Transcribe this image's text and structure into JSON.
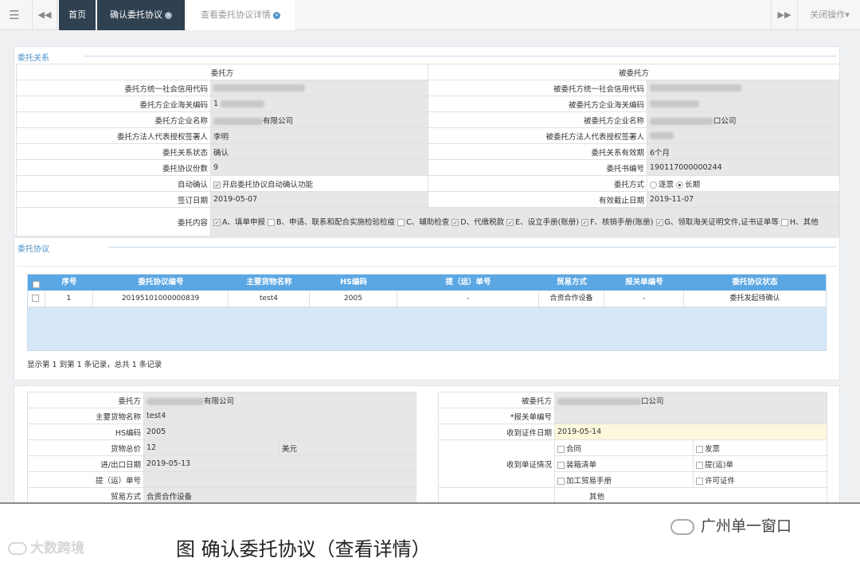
{
  "topbar": {
    "menu_icon": "☰",
    "back_icon": "◀◀",
    "home": "首页",
    "tab_active": "确认委托协议",
    "tab_detail": "查看委托协议详情",
    "fwd_icon": "▶▶",
    "close_ops": "关闭操作▾"
  },
  "relation": {
    "title": "委托关系",
    "head_left": "委托方",
    "head_right": "被委托方",
    "rows": [
      {
        "l1": "委托方统一社会信用代码",
        "v1": "",
        "l2": "被委托方统一社会信用代码",
        "v2": ""
      },
      {
        "l1": "委托方企业海关编码",
        "v1": "1",
        "l2": "被委托方企业海关编码",
        "v2": ""
      },
      {
        "l1": "委托方企业名称",
        "v1": "有限公司",
        "l2": "被委托方企业名称",
        "v2": "口公司"
      },
      {
        "l1": "委托方法人代表授权签署人",
        "v1": "李明",
        "l2": "被委托方法人代表授权签署人",
        "v2": ""
      },
      {
        "l1": "委托关系状态",
        "v1": "确认",
        "l2": "委托关系有效期",
        "v2": "6个月"
      },
      {
        "l1": "委托协议份数",
        "v1": "9",
        "l2": "委托书编号",
        "v2": "190117000000244"
      }
    ],
    "auto_label": "自动确认",
    "auto_text": "开启委托协议自动确认功能",
    "mode_label": "委托方式",
    "mode_opt1": "逐票",
    "mode_opt2": "长期",
    "sign_label": "签订日期",
    "sign_date": "2019-05-07",
    "end_label": "有效截止日期",
    "end_date": "2019-11-07",
    "content_label": "委托内容",
    "content_items": [
      "A、填单申报",
      "B、申请、联系和配合实施检验检疫",
      "C、辅助检查",
      "D、代缴税款",
      "E、设立手册(账册)",
      "F、核销手册(账册)",
      "G、领取海关证明文件,证书证单等",
      "H、其他"
    ]
  },
  "agreement": {
    "title": "委托协议",
    "columns": [
      "序号",
      "委托协议编号",
      "主要货物名称",
      "HS编码",
      "提（运）单号",
      "贸易方式",
      "报关单编号",
      "委托协议状态"
    ],
    "rows": [
      [
        "1",
        "20195101000000839",
        "test4",
        "2005",
        "-",
        "合资合作设备",
        "-",
        "委托发起待确认"
      ]
    ],
    "footer": "显示第 1 到第 1 条记录，总共 1 条记录"
  },
  "detail": {
    "left": [
      {
        "label": "委托方",
        "value": "有限公司"
      },
      {
        "label": "主要货物名称",
        "value": "test4"
      },
      {
        "label": "HS编码",
        "value": "2005"
      },
      {
        "label": "货物总价",
        "value": "12",
        "unit": "美元"
      },
      {
        "label": "进/出口日期",
        "value": "2019-05-13"
      },
      {
        "label": "提（运）单号",
        "value": ""
      },
      {
        "label": "贸易方式",
        "value": "合资合作设备"
      }
    ],
    "right": {
      "principal_label": "被委托方",
      "principal_value": "口公司",
      "decl_label": "*报关单编号",
      "decl_value": "",
      "recv_date_label": "收到证件日期",
      "recv_date_value": "2019-05-14",
      "docs_label": "收到单证情况",
      "docs": [
        "合同",
        "发票",
        "装箱清单",
        "提(运)单",
        "加工贸易手册",
        "许可证件"
      ],
      "other_label": "其他"
    }
  },
  "caption": {
    "title": "图  确认委托协议（查看详情）",
    "watermark_left": "大数跨境",
    "watermark_right": "广州单一窗口"
  }
}
